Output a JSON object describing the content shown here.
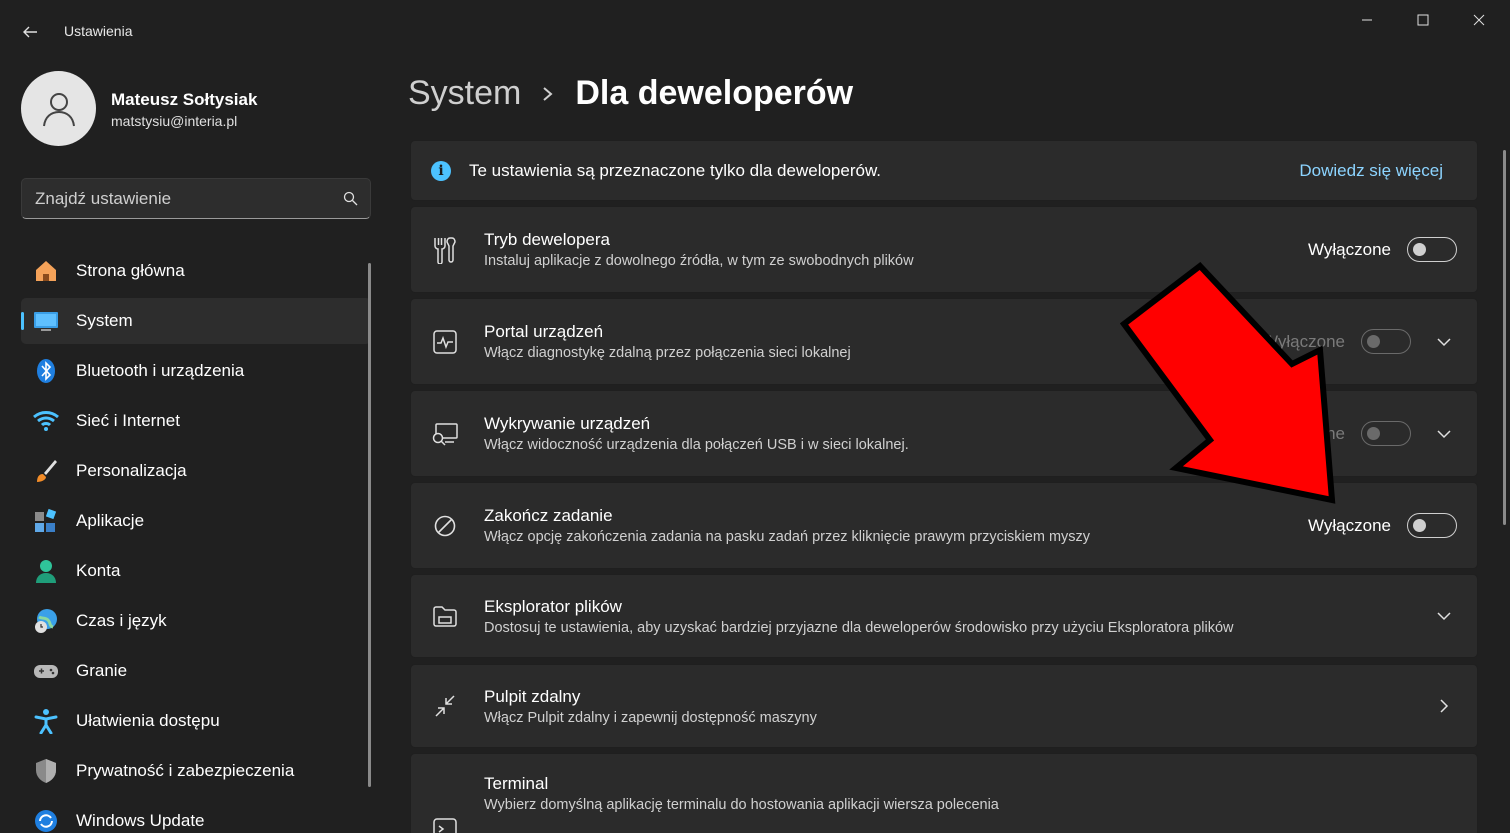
{
  "window": {
    "title": "Ustawienia"
  },
  "profile": {
    "name": "Mateusz Sołtysiak",
    "email": "matstysiu@interia.pl"
  },
  "search": {
    "placeholder": "Znajdź ustawienie"
  },
  "sidebar": {
    "items": [
      {
        "label": "Strona główna",
        "icon": "home-icon"
      },
      {
        "label": "System",
        "icon": "monitor-icon",
        "active": true
      },
      {
        "label": "Bluetooth i urządzenia",
        "icon": "bluetooth-icon"
      },
      {
        "label": "Sieć i Internet",
        "icon": "wifi-icon"
      },
      {
        "label": "Personalizacja",
        "icon": "brush-icon"
      },
      {
        "label": "Aplikacje",
        "icon": "apps-icon"
      },
      {
        "label": "Konta",
        "icon": "person-icon"
      },
      {
        "label": "Czas i język",
        "icon": "globe-clock-icon"
      },
      {
        "label": "Granie",
        "icon": "gamepad-icon"
      },
      {
        "label": "Ułatwienia dostępu",
        "icon": "accessibility-icon"
      },
      {
        "label": "Prywatność i zabezpieczenia",
        "icon": "shield-icon"
      },
      {
        "label": "Windows Update",
        "icon": "update-icon"
      }
    ]
  },
  "breadcrumb": {
    "parent": "System",
    "current": "Dla deweloperów"
  },
  "info": {
    "text": "Te ustawienia są przeznaczone tylko dla deweloperów.",
    "link": "Dowiedz się więcej"
  },
  "settings": [
    {
      "title": "Tryb dewelopera",
      "desc": "Instaluj aplikacje z dowolnego źródła, w tym ze swobodnych plików",
      "toggle_label": "Wyłączone",
      "icon": "tools-icon"
    },
    {
      "title": "Portal urządzeń",
      "desc": "Włącz diagnostykę zdalną przez połączenia sieci lokalnej",
      "toggle_label": "Wyłączone",
      "icon": "pulse-icon"
    },
    {
      "title": "Wykrywanie urządzeń",
      "desc": "Włącz widoczność urządzenia dla połączeń USB i w sieci lokalnej.",
      "toggle_label": "Wyłączone",
      "icon": "device-search-icon"
    },
    {
      "title": "Zakończ zadanie",
      "desc": "Włącz opcję zakończenia zadania na pasku zadań przez kliknięcie prawym przyciskiem myszy",
      "toggle_label": "Wyłączone",
      "icon": "block-icon"
    },
    {
      "title": "Eksplorator plików",
      "desc": "Dostosuj te ustawienia, aby uzyskać bardziej przyjazne dla deweloperów środowisko przy użyciu Eksploratora plików",
      "icon": "folder-icon"
    },
    {
      "title": "Pulpit zdalny",
      "desc": "Włącz Pulpit zdalny i zapewnij dostępność maszyny",
      "icon": "remote-icon"
    },
    {
      "title": "Terminal",
      "desc": "Wybierz domyślną aplikację terminalu do hostowania aplikacji wiersza polecenia",
      "icon": "terminal-icon"
    }
  ],
  "colors": {
    "accent": "#4cc2ff",
    "annotation": "#ff0000"
  }
}
